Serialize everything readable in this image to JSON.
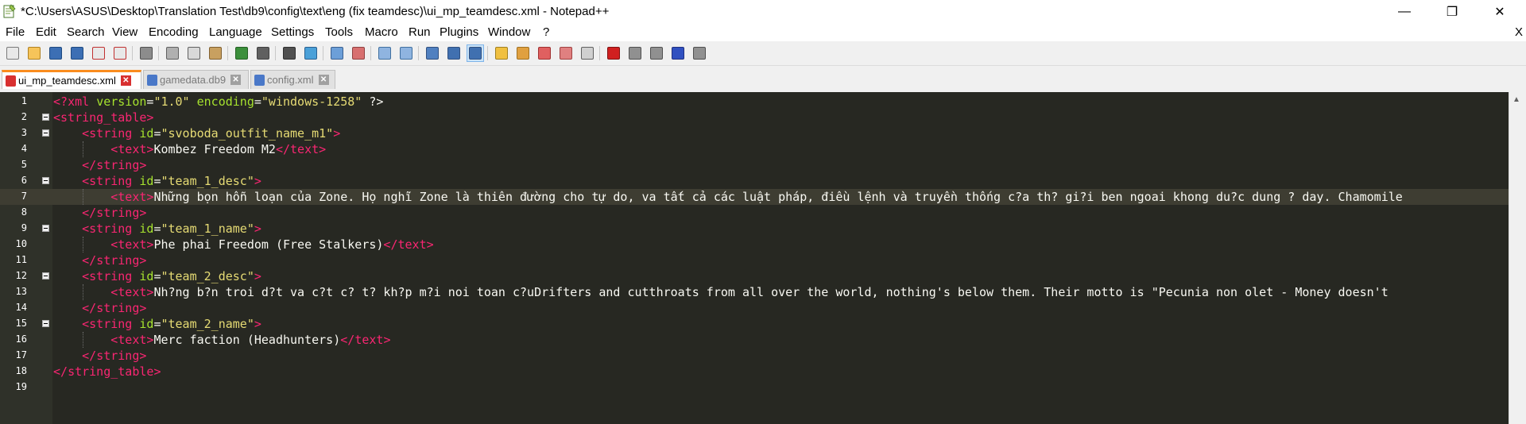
{
  "window": {
    "title": "*C:\\Users\\ASUS\\Desktop\\Translation Test\\db9\\config\\text\\eng (fix teamdesc)\\ui_mp_teamdesc.xml - Notepad++",
    "minimize": "—",
    "maximize": "❐",
    "close": "✕"
  },
  "menu": {
    "items": [
      "File",
      "Edit",
      "Search",
      "View",
      "Encoding",
      "Language",
      "Settings",
      "Tools",
      "Macro",
      "Run",
      "Plugins",
      "Window",
      "?"
    ],
    "close_doc": "X"
  },
  "toolbar": {
    "icons": [
      {
        "name": "new-file-icon",
        "color": "#e8e8e8",
        "border": "#7a7a7a"
      },
      {
        "name": "open-file-icon",
        "color": "#f6c45a",
        "border": "#b08020"
      },
      {
        "name": "save-icon",
        "color": "#3c6fb4",
        "border": "#1f4a80"
      },
      {
        "name": "save-all-icon",
        "color": "#3c6fb4",
        "border": "#1f4a80"
      },
      {
        "name": "close-file-icon",
        "color": "#e8e8e8",
        "border": "#c03030"
      },
      {
        "name": "close-all-icon",
        "color": "#e8e8e8",
        "border": "#c03030"
      },
      {
        "name": "print-icon",
        "color": "#8c8c8c",
        "border": "#505050"
      },
      {
        "name": "cut-icon",
        "color": "#b0b0b0",
        "border": "#606060"
      },
      {
        "name": "copy-icon",
        "color": "#d8d8d8",
        "border": "#606060"
      },
      {
        "name": "paste-icon",
        "color": "#c8a060",
        "border": "#806030"
      },
      {
        "name": "undo-icon",
        "color": "#3b8f3b",
        "border": "#236023"
      },
      {
        "name": "redo-icon",
        "color": "#606060",
        "border": "#404040"
      },
      {
        "name": "find-icon",
        "color": "#505050",
        "border": "#303030"
      },
      {
        "name": "replace-icon",
        "color": "#4aa0d8",
        "border": "#2a6090"
      },
      {
        "name": "zoom-in-icon",
        "color": "#6c9fd8",
        "border": "#3a6090"
      },
      {
        "name": "zoom-out-icon",
        "color": "#d87070",
        "border": "#904040"
      },
      {
        "name": "sync-vertical-icon",
        "color": "#8fb4e0",
        "border": "#4070a0"
      },
      {
        "name": "sync-horizontal-icon",
        "color": "#8fb4e0",
        "border": "#4070a0"
      },
      {
        "name": "word-wrap-icon",
        "color": "#5080c0",
        "border": "#305080"
      },
      {
        "name": "show-all-chars-icon",
        "color": "#4070b0",
        "border": "#305080"
      },
      {
        "name": "indent-guide-icon",
        "color": "#4070b0",
        "border": "#305080"
      },
      {
        "name": "user-language-icon",
        "color": "#f0c040",
        "border": "#a08020"
      },
      {
        "name": "doc-map-icon",
        "color": "#e0a040",
        "border": "#a07020"
      },
      {
        "name": "function-list-icon",
        "color": "#e06060",
        "border": "#a03030"
      },
      {
        "name": "folder-workspace-icon",
        "color": "#e08080",
        "border": "#a04040"
      },
      {
        "name": "monitoring-icon",
        "color": "#d0d0d0",
        "border": "#606060"
      },
      {
        "name": "record-macro-icon",
        "color": "#d02020",
        "border": "#801010"
      },
      {
        "name": "stop-macro-icon",
        "color": "#909090",
        "border": "#505050"
      },
      {
        "name": "play-macro-icon",
        "color": "#909090",
        "border": "#505050"
      },
      {
        "name": "run-macro-multiple-icon",
        "color": "#3050c0",
        "border": "#203080"
      },
      {
        "name": "save-macro-icon",
        "color": "#909090",
        "border": "#505050"
      }
    ]
  },
  "tabs": [
    {
      "label": "ui_mp_teamdesc.xml",
      "active": true,
      "icon_color": "#d83030",
      "close_color": "#d83030"
    },
    {
      "label": "gamedata.db9",
      "active": false,
      "icon_color": "#4a78c8",
      "close_color": "#a0a0a0"
    },
    {
      "label": "config.xml",
      "active": false,
      "icon_color": "#4a78c8",
      "close_color": "#a0a0a0"
    }
  ],
  "editor": {
    "current_line": 7,
    "lines": [
      {
        "n": "1",
        "fold": false,
        "tokens": [
          [
            "br",
            "<?"
          ],
          [
            "pi",
            "xml"
          ],
          [
            "txt",
            " "
          ],
          [
            "attr",
            "version"
          ],
          [
            "txt",
            "="
          ],
          [
            "val",
            "\"1.0\""
          ],
          [
            "txt",
            " "
          ],
          [
            "attr",
            "encoding"
          ],
          [
            "txt",
            "="
          ],
          [
            "val",
            "\"windows-1258\""
          ],
          [
            "txt",
            " ?>"
          ]
        ]
      },
      {
        "n": "2",
        "fold": true,
        "tokens": [
          [
            "br",
            "<"
          ],
          [
            "tag",
            "string_table"
          ],
          [
            "br",
            ">"
          ]
        ]
      },
      {
        "n": "3",
        "fold": true,
        "tokens": [
          [
            "txt",
            "    "
          ],
          [
            "br",
            "<"
          ],
          [
            "tag",
            "string"
          ],
          [
            "txt",
            " "
          ],
          [
            "attr",
            "id"
          ],
          [
            "txt",
            "="
          ],
          [
            "val",
            "\"svoboda_outfit_name_m1\""
          ],
          [
            "br",
            ">"
          ]
        ]
      },
      {
        "n": "4",
        "fold": false,
        "tokens": [
          [
            "txt",
            "        "
          ],
          [
            "br",
            "<"
          ],
          [
            "tag",
            "text"
          ],
          [
            "br",
            ">"
          ],
          [
            "txt",
            "Kombez Freedom M2"
          ],
          [
            "br",
            "</"
          ],
          [
            "tag",
            "text"
          ],
          [
            "br",
            ">"
          ]
        ]
      },
      {
        "n": "5",
        "fold": false,
        "tokens": [
          [
            "txt",
            "    "
          ],
          [
            "br",
            "</"
          ],
          [
            "tag",
            "string"
          ],
          [
            "br",
            ">"
          ]
        ]
      },
      {
        "n": "6",
        "fold": true,
        "tokens": [
          [
            "txt",
            "    "
          ],
          [
            "br",
            "<"
          ],
          [
            "tag",
            "string"
          ],
          [
            "txt",
            " "
          ],
          [
            "attr",
            "id"
          ],
          [
            "txt",
            "="
          ],
          [
            "val",
            "\"team_1_desc\""
          ],
          [
            "br",
            ">"
          ]
        ]
      },
      {
        "n": "7",
        "fold": false,
        "tokens": [
          [
            "txt",
            "        "
          ],
          [
            "br",
            "<"
          ],
          [
            "tag",
            "text"
          ],
          [
            "br",
            ">"
          ],
          [
            "txt",
            "Những bọn hỗn loạn của Zone. Họ nghĩ Zone là thiên đường cho tự do, va tất cả các luật pháp, điều lệnh và truyền thống c?a th? gi?i ben ngoai khong du?c dung ? day. Chamomile"
          ]
        ]
      },
      {
        "n": "8",
        "fold": false,
        "tokens": [
          [
            "txt",
            "    "
          ],
          [
            "br",
            "</"
          ],
          [
            "tag",
            "string"
          ],
          [
            "br",
            ">"
          ]
        ]
      },
      {
        "n": "9",
        "fold": true,
        "tokens": [
          [
            "txt",
            "    "
          ],
          [
            "br",
            "<"
          ],
          [
            "tag",
            "string"
          ],
          [
            "txt",
            " "
          ],
          [
            "attr",
            "id"
          ],
          [
            "txt",
            "="
          ],
          [
            "val",
            "\"team_1_name\""
          ],
          [
            "br",
            ">"
          ]
        ]
      },
      {
        "n": "10",
        "fold": false,
        "tokens": [
          [
            "txt",
            "        "
          ],
          [
            "br",
            "<"
          ],
          [
            "tag",
            "text"
          ],
          [
            "br",
            ">"
          ],
          [
            "txt",
            "Phe phai Freedom (Free Stalkers)"
          ],
          [
            "br",
            "</"
          ],
          [
            "tag",
            "text"
          ],
          [
            "br",
            ">"
          ]
        ]
      },
      {
        "n": "11",
        "fold": false,
        "tokens": [
          [
            "txt",
            "    "
          ],
          [
            "br",
            "</"
          ],
          [
            "tag",
            "string"
          ],
          [
            "br",
            ">"
          ]
        ]
      },
      {
        "n": "12",
        "fold": true,
        "tokens": [
          [
            "txt",
            "    "
          ],
          [
            "br",
            "<"
          ],
          [
            "tag",
            "string"
          ],
          [
            "txt",
            " "
          ],
          [
            "attr",
            "id"
          ],
          [
            "txt",
            "="
          ],
          [
            "val",
            "\"team_2_desc\""
          ],
          [
            "br",
            ">"
          ]
        ]
      },
      {
        "n": "13",
        "fold": false,
        "tokens": [
          [
            "txt",
            "        "
          ],
          [
            "br",
            "<"
          ],
          [
            "tag",
            "text"
          ],
          [
            "br",
            ">"
          ],
          [
            "txt",
            "Nh?ng b?n troi d?t va c?t c? t? kh?p m?i noi toan c?uDrifters and cutthroats from all over the world, nothing's below them. Their motto is \"Pecunia non olet - Money doesn't"
          ]
        ]
      },
      {
        "n": "14",
        "fold": false,
        "tokens": [
          [
            "txt",
            "    "
          ],
          [
            "br",
            "</"
          ],
          [
            "tag",
            "string"
          ],
          [
            "br",
            ">"
          ]
        ]
      },
      {
        "n": "15",
        "fold": true,
        "tokens": [
          [
            "txt",
            "    "
          ],
          [
            "br",
            "<"
          ],
          [
            "tag",
            "string"
          ],
          [
            "txt",
            " "
          ],
          [
            "attr",
            "id"
          ],
          [
            "txt",
            "="
          ],
          [
            "val",
            "\"team_2_name\""
          ],
          [
            "br",
            ">"
          ]
        ]
      },
      {
        "n": "16",
        "fold": false,
        "tokens": [
          [
            "txt",
            "        "
          ],
          [
            "br",
            "<"
          ],
          [
            "tag",
            "text"
          ],
          [
            "br",
            ">"
          ],
          [
            "txt",
            "Merc faction (Headhunters)"
          ],
          [
            "br",
            "</"
          ],
          [
            "tag",
            "text"
          ],
          [
            "br",
            ">"
          ]
        ]
      },
      {
        "n": "17",
        "fold": false,
        "tokens": [
          [
            "txt",
            "    "
          ],
          [
            "br",
            "</"
          ],
          [
            "tag",
            "string"
          ],
          [
            "br",
            ">"
          ]
        ]
      },
      {
        "n": "18",
        "fold": false,
        "tokens": [
          [
            "br",
            "</"
          ],
          [
            "tag",
            "string_table"
          ],
          [
            "br",
            ">"
          ]
        ]
      },
      {
        "n": "19",
        "fold": false,
        "tokens": []
      }
    ]
  },
  "scrollbar": {
    "up_arrow": "▲"
  }
}
